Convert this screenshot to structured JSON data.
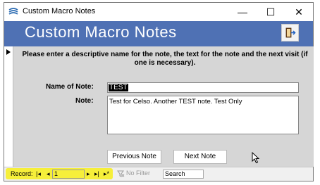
{
  "window": {
    "title": "Custom Macro Notes",
    "minimize": "—",
    "maximize": "☐",
    "close": "✕"
  },
  "header": {
    "title": "Custom Macro Notes",
    "exit_icon": "exit-door-icon"
  },
  "form": {
    "instructions": "Please enter a descriptive name for the note, the text for the note and the next visit (if one is necessary).",
    "name_label": "Name of Note:",
    "name_value": "TEST",
    "note_label": "Note:",
    "note_value": "Test for Celso. Another TEST note. Test Only",
    "prev_button": "Previous Note",
    "next_button": "Next Note"
  },
  "navigation": {
    "record_label": "Record:",
    "first": "|◂",
    "prev": "◂",
    "record_value": "1",
    "next": "▸",
    "last": "▸|",
    "new": "▸*",
    "filter_text": "No Filter",
    "search_placeholder": "Search"
  },
  "colors": {
    "header_bg": "#4f71b4",
    "detail_bg": "#d6d6d6",
    "highlight": "#f6ef3a"
  }
}
